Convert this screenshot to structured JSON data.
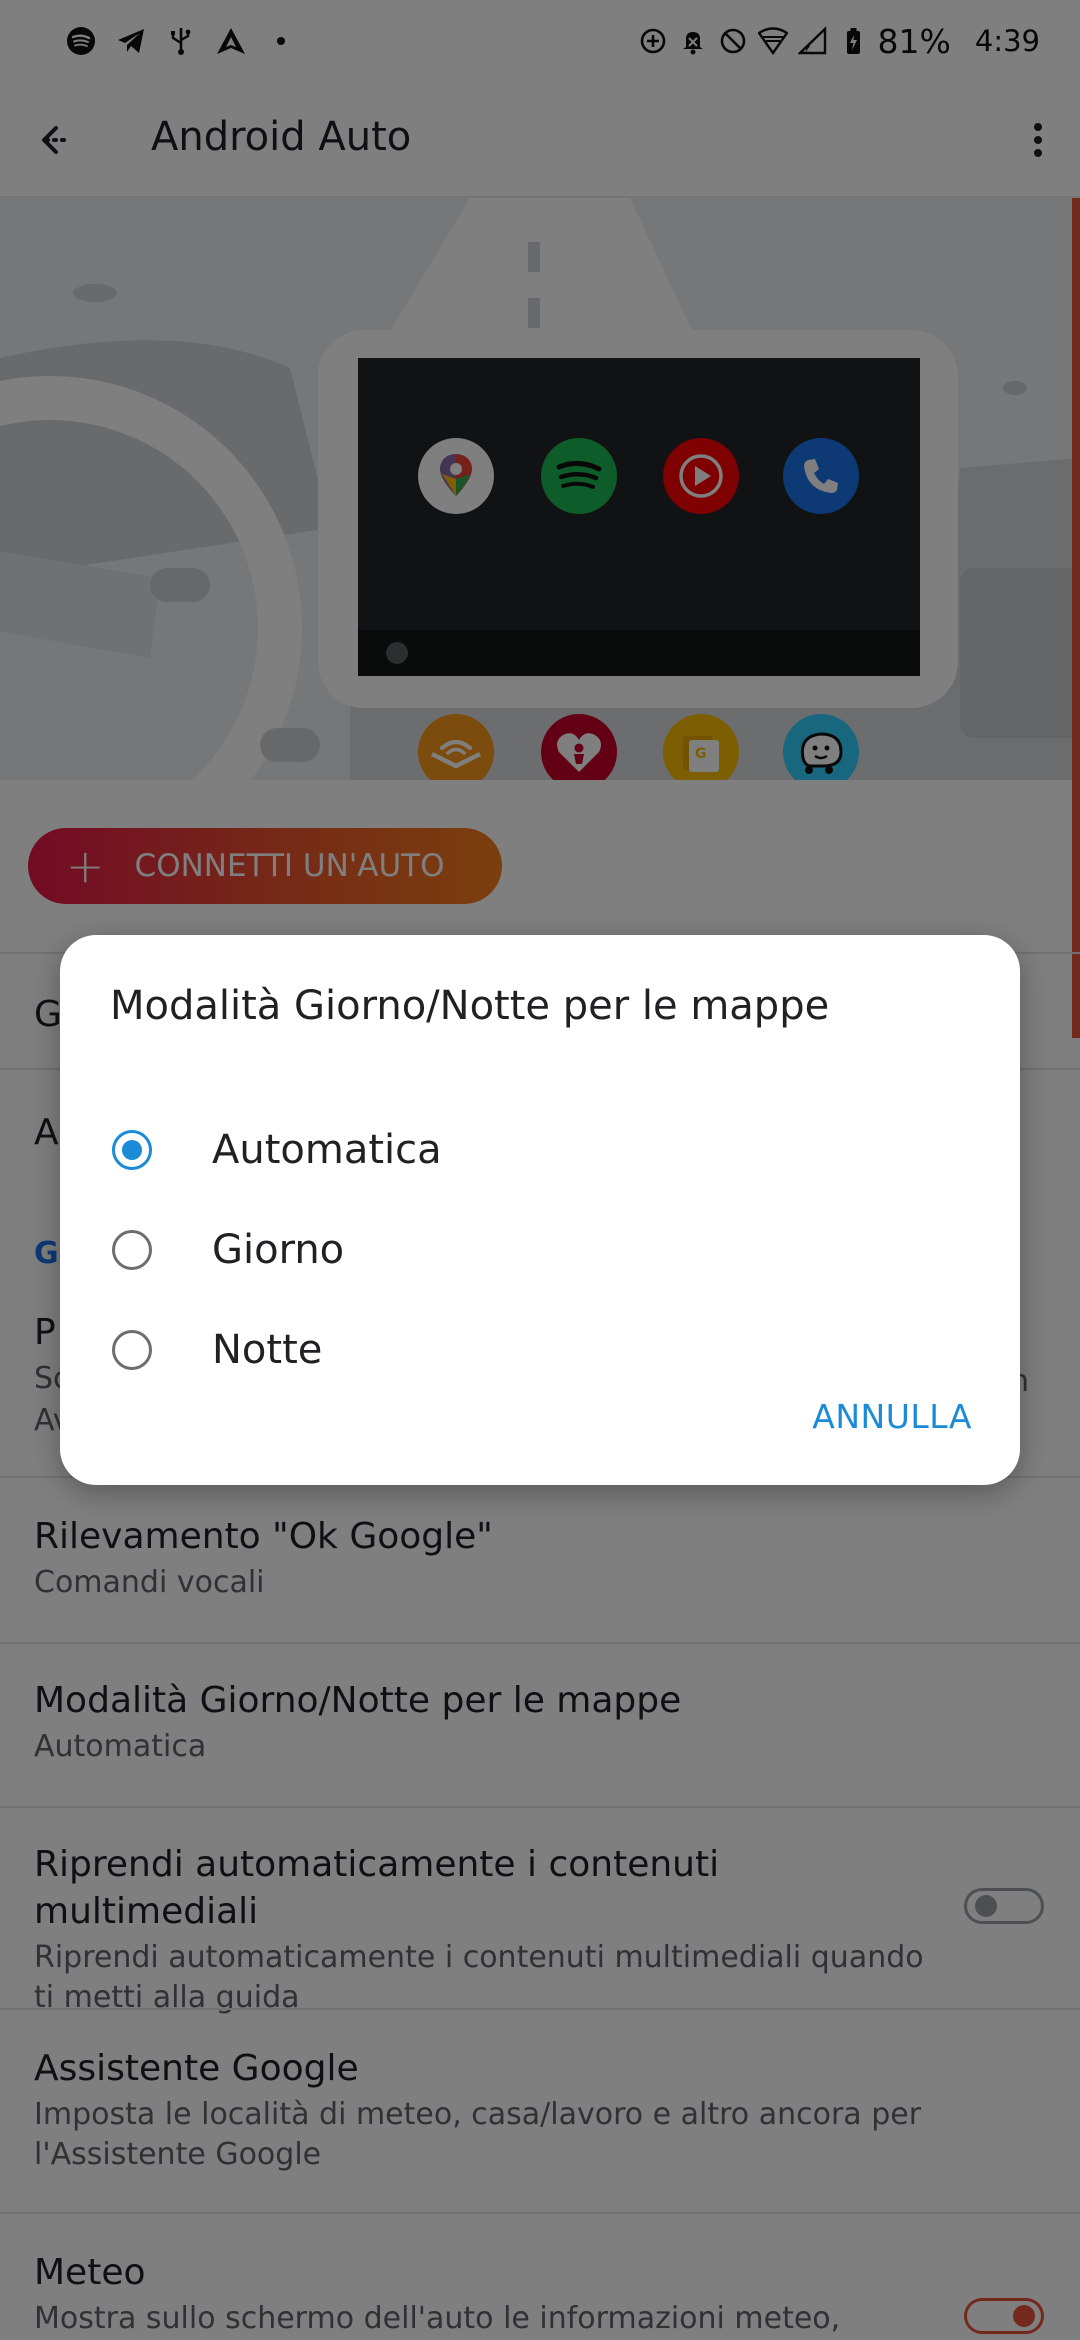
{
  "status_bar": {
    "battery": "81%",
    "time": "4:39",
    "left_icons": [
      "spotify-icon",
      "telegram-icon",
      "usb-icon",
      "android-auto-icon",
      "dot-icon"
    ],
    "right_icons": [
      "data-saver-icon",
      "notifications-off-icon",
      "dnd-icon",
      "wifi-icon",
      "signal-icon",
      "battery-icon"
    ]
  },
  "toolbar": {
    "title": "Android Auto"
  },
  "hero": {
    "apps": [
      "maps",
      "spotify",
      "youtube-music",
      "phone",
      "audible",
      "iheartradio",
      "google-news",
      "waze"
    ]
  },
  "settings": {
    "connect_button": "CONNETTI UN'AUTO",
    "partial_row_1": "G",
    "partial_row_2": "A",
    "partial_section": "G",
    "partial_row_3_title": "P",
    "partial_row_3_sub_a": "Sc",
    "partial_row_3_sub_b": "Av",
    "partial_row_3_sub_end": "n",
    "rows": [
      {
        "title": "Rilevamento \"Ok Google\"",
        "subtitle": "Comandi vocali"
      },
      {
        "title": "Modalità Giorno/Notte per le mappe",
        "subtitle": "Automatica"
      },
      {
        "title": "Riprendi automaticamente i contenuti multimediali",
        "subtitle": "Riprendi automaticamente i contenuti multimediali quando ti metti alla guida"
      },
      {
        "title": "Assistente Google",
        "subtitle": "Imposta le località di meteo, casa/lavoro e altro ancora per l'Assistente Google"
      },
      {
        "title": "Meteo",
        "subtitle": "Mostra sullo schermo dell'auto le informazioni meteo,"
      }
    ],
    "toggle_resume": false,
    "toggle_weather": true
  },
  "dialog": {
    "title": "Modalità Giorno/Notte per le mappe",
    "options": [
      {
        "label": "Automatica",
        "selected": true
      },
      {
        "label": "Giorno",
        "selected": false
      },
      {
        "label": "Notte",
        "selected": false
      }
    ],
    "cancel": "ANNULLA"
  },
  "colors": {
    "accent": "#1b8bd8",
    "section_header": "#1a73e8",
    "connect_gradient_start": "#e5164a",
    "connect_gradient_end": "#f57f1c",
    "toggle_on": "#e8533a"
  }
}
